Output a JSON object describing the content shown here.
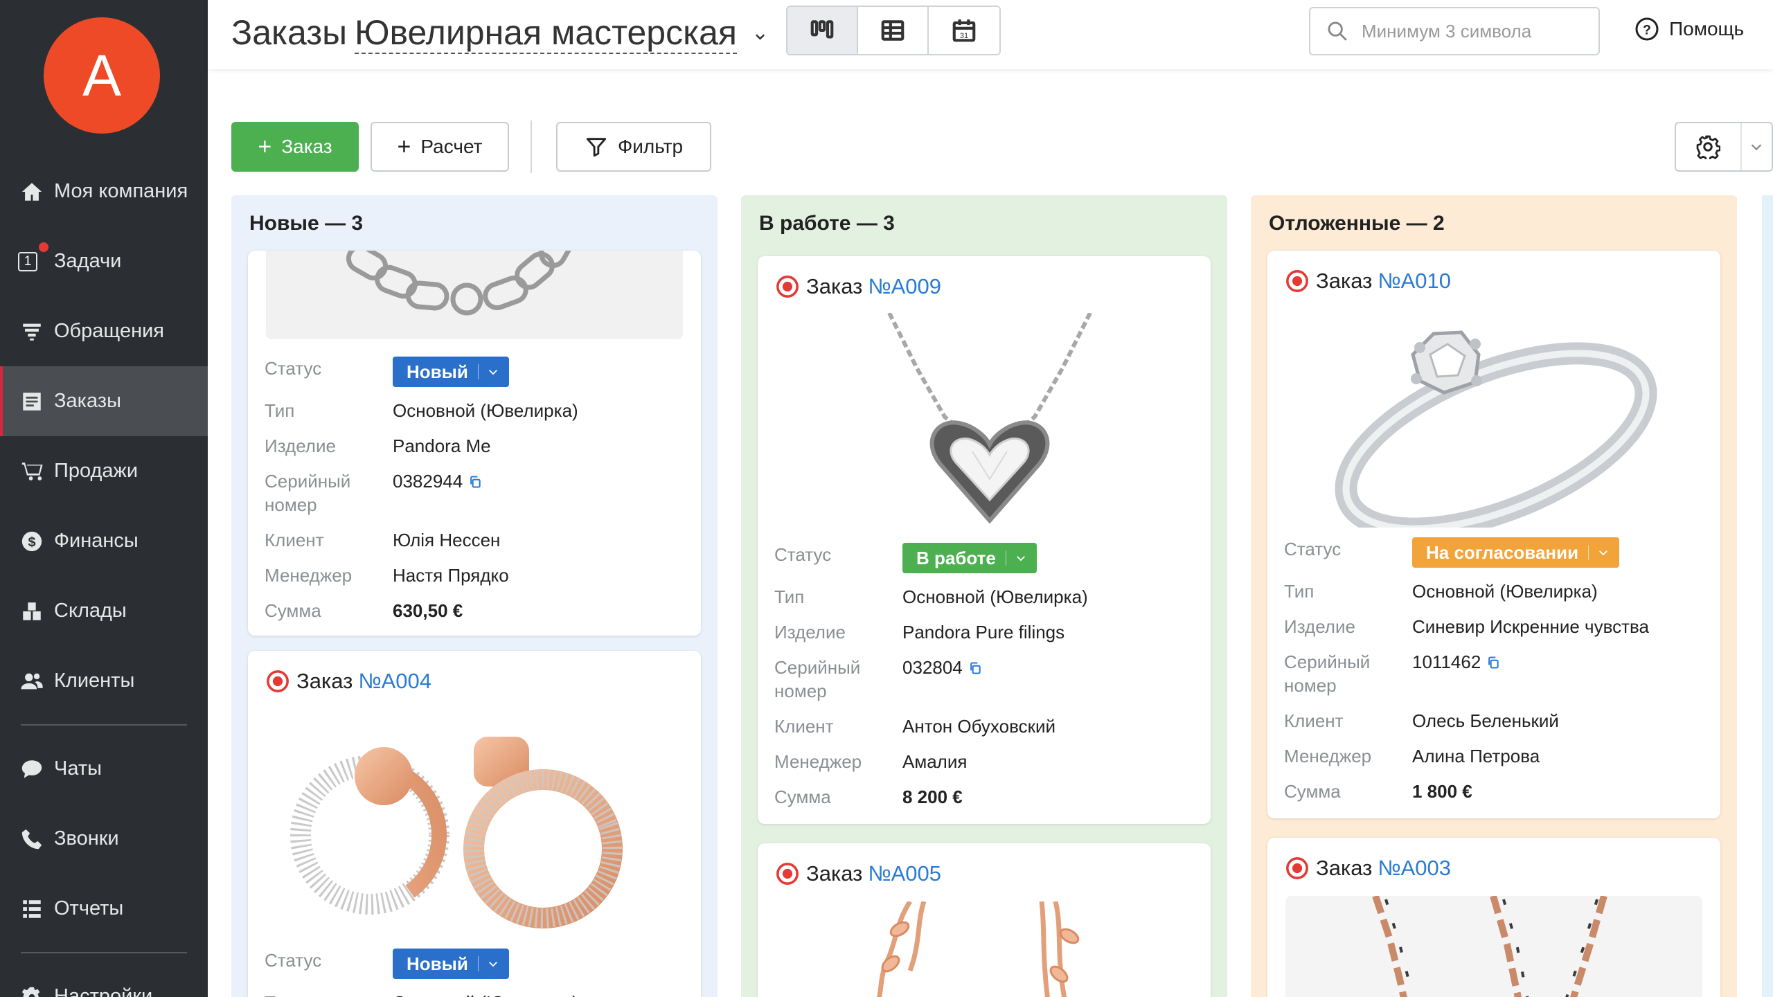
{
  "user": {
    "avatar_letter": "A"
  },
  "sidebar": {
    "items": [
      {
        "label": "Моя компания",
        "icon": "home-icon"
      },
      {
        "label": "Задачи",
        "icon": "tasks-icon",
        "badge": "1"
      },
      {
        "label": "Обращения",
        "icon": "funnel-icon"
      },
      {
        "label": "Заказы",
        "icon": "orders-icon",
        "active": true
      },
      {
        "label": "Продажи",
        "icon": "cart-icon"
      },
      {
        "label": "Финансы",
        "icon": "dollar-icon"
      },
      {
        "label": "Склады",
        "icon": "warehouse-icon"
      },
      {
        "label": "Клиенты",
        "icon": "clients-icon"
      },
      {
        "label": "Чаты",
        "icon": "chat-icon"
      },
      {
        "label": "Звонки",
        "icon": "phone-icon"
      },
      {
        "label": "Отчеты",
        "icon": "reports-icon"
      },
      {
        "label": "Настройки",
        "icon": "gear-icon"
      }
    ]
  },
  "header": {
    "title": "Заказы",
    "workspace": "Ювелирная мастерская",
    "search_placeholder": "Минимум 3 символа",
    "help_label": "Помощь"
  },
  "toolbar": {
    "order_label": "Заказ",
    "calc_label": "Расчет",
    "filter_label": "Фильтр"
  },
  "labels": {
    "order_prefix": "Заказ",
    "status": "Статус",
    "type": "Тип",
    "item": "Изделие",
    "serial": "Серийный номер",
    "client": "Клиент",
    "manager": "Менеджер",
    "sum": "Сумма"
  },
  "columns": [
    {
      "title": "Новые — 3",
      "color": "#eaf1fa",
      "cards": [
        {
          "status": "Новый",
          "status_color": "#2a6fc9",
          "type": "Основной (Ювелирка)",
          "item": "Pandora Me",
          "serial": "0382944",
          "client": "Юлія Нессен",
          "manager": "Настя Прядко",
          "sum": "630,50 €"
        },
        {
          "number": "№A004",
          "status": "Новый",
          "status_color": "#2a6fc9",
          "type": "Основной (Ювелирка)"
        }
      ]
    },
    {
      "title": "В работе — 3",
      "color": "#e3f2e0",
      "cards": [
        {
          "number": "№A009",
          "status": "В работе",
          "status_color": "#4caf50",
          "type": "Основной (Ювелирка)",
          "item": "Pandora Pure filings",
          "serial": "032804",
          "client": "Антон Обуховский",
          "manager": "Амалия",
          "sum": "8 200 €"
        },
        {
          "number": "№A005"
        }
      ]
    },
    {
      "title": "Отложенные — 2",
      "color": "#fdebd5",
      "cards": [
        {
          "number": "№A010",
          "status": "На согласовании",
          "status_color": "#f2a33a",
          "type": "Основной (Ювелирка)",
          "item": "Синевир Искренние чувства",
          "serial": "1011462",
          "client": "Олесь Беленький",
          "manager": "Алина Петрова",
          "sum": "1 800 €"
        },
        {
          "number": "№A003"
        }
      ]
    }
  ]
}
